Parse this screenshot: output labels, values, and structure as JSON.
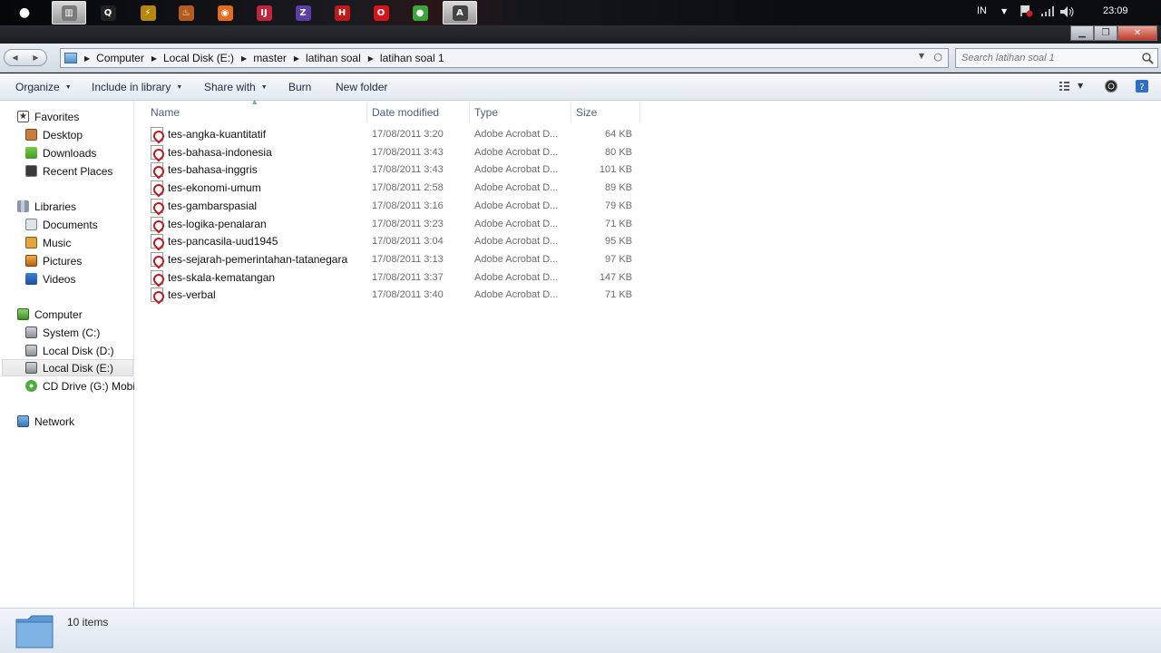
{
  "taskbar": {
    "apps": [
      {
        "name": "apple-menu",
        "glyph": ""
      },
      {
        "name": "explorer",
        "glyph": "▥",
        "color": "#7a7a7a",
        "active": true
      },
      {
        "name": "quicksearch",
        "glyph": "Q",
        "color": "#222"
      },
      {
        "name": "winamp",
        "glyph": "⚡",
        "color": "#b8860b"
      },
      {
        "name": "paint-tool",
        "glyph": "♨",
        "color": "#b35c1e"
      },
      {
        "name": "firefox",
        "glyph": "◉",
        "color": "#e56b1f"
      },
      {
        "name": "ide-app",
        "glyph": "IJ",
        "color": "#c0263a"
      },
      {
        "name": "zend-app",
        "glyph": "Z",
        "color": "#5b3ea8"
      },
      {
        "name": "h-app",
        "glyph": "H",
        "color": "#c0181b"
      },
      {
        "name": "opera",
        "glyph": "O",
        "color": "#d4131b"
      },
      {
        "name": "green-app",
        "glyph": "●",
        "color": "#3aa53a"
      },
      {
        "name": "acrobat",
        "glyph": "A",
        "color": "#444",
        "active": true
      }
    ],
    "lang": "IN",
    "clock": "23:09"
  },
  "address": {
    "crumbs": [
      "Computer",
      "Local Disk (E:)",
      "master",
      "latihan soal",
      "latihan soal 1"
    ]
  },
  "search": {
    "placeholder": "Search latihan soal 1"
  },
  "toolbar": {
    "organize": "Organize",
    "include": "Include in library",
    "share": "Share with",
    "burn": "Burn",
    "new_folder": "New folder"
  },
  "nav": {
    "favorites": "Favorites",
    "desktop": "Desktop",
    "downloads": "Downloads",
    "recent": "Recent Places",
    "libraries": "Libraries",
    "documents": "Documents",
    "music": "Music",
    "pictures": "Pictures",
    "videos": "Videos",
    "computer": "Computer",
    "system_c": "System (C:)",
    "local_d": "Local Disk (D:)",
    "local_e": "Local Disk (E:)",
    "cd_drive": "CD Drive (G:) Mobile",
    "network": "Network"
  },
  "columns": {
    "name": "Name",
    "date": "Date modified",
    "type": "Type",
    "size": "Size"
  },
  "files": [
    {
      "name": "tes-angka-kuantitatif",
      "date": "17/08/2011 3:20",
      "type": "Adobe Acrobat D...",
      "size": "64 KB"
    },
    {
      "name": "tes-bahasa-indonesia",
      "date": "17/08/2011 3:43",
      "type": "Adobe Acrobat D...",
      "size": "80 KB"
    },
    {
      "name": "tes-bahasa-inggris",
      "date": "17/08/2011 3:43",
      "type": "Adobe Acrobat D...",
      "size": "101 KB"
    },
    {
      "name": "tes-ekonomi-umum",
      "date": "17/08/2011 2:58",
      "type": "Adobe Acrobat D...",
      "size": "89 KB"
    },
    {
      "name": "tes-gambarspasial",
      "date": "17/08/2011 3:16",
      "type": "Adobe Acrobat D...",
      "size": "79 KB"
    },
    {
      "name": "tes-logika-penalaran",
      "date": "17/08/2011 3:23",
      "type": "Adobe Acrobat D...",
      "size": "71 KB"
    },
    {
      "name": "tes-pancasila-uud1945",
      "date": "17/08/2011 3:04",
      "type": "Adobe Acrobat D...",
      "size": "95 KB"
    },
    {
      "name": "tes-sejarah-pemerintahan-tatanegara",
      "date": "17/08/2011 3:13",
      "type": "Adobe Acrobat D...",
      "size": "97 KB"
    },
    {
      "name": "tes-skala-kematangan",
      "date": "17/08/2011 3:37",
      "type": "Adobe Acrobat D...",
      "size": "147 KB"
    },
    {
      "name": "tes-verbal",
      "date": "17/08/2011 3:40",
      "type": "Adobe Acrobat D...",
      "size": "71 KB"
    }
  ],
  "status": {
    "count": "10 items"
  }
}
